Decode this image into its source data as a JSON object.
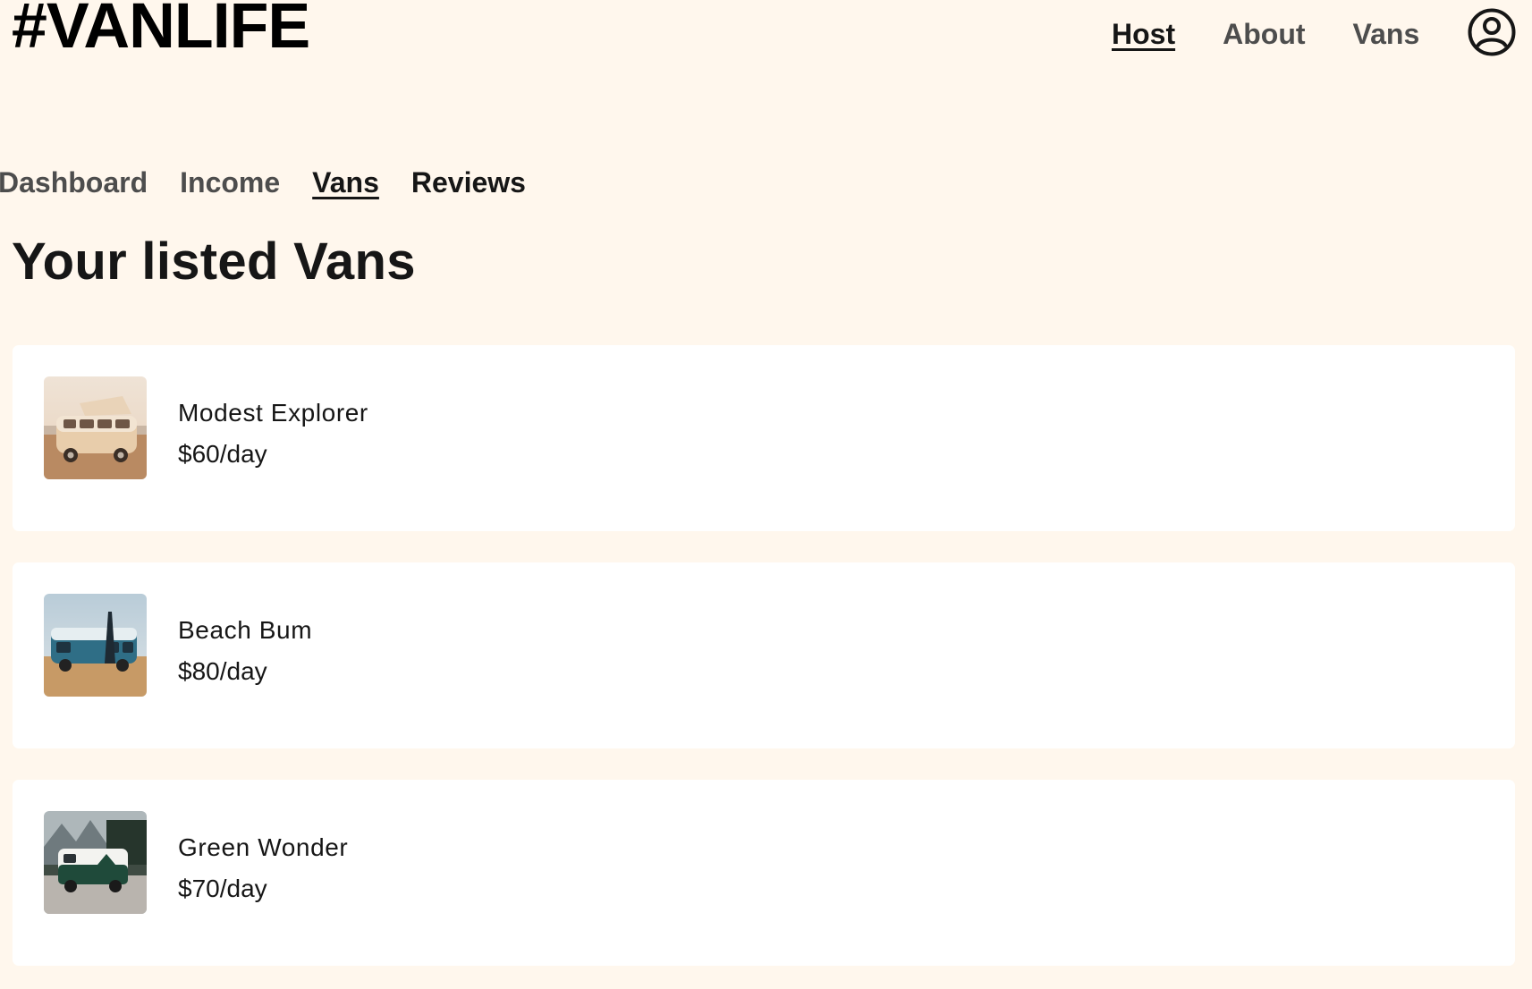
{
  "header": {
    "logo": "#VANLIFE",
    "nav": [
      {
        "label": "Host",
        "active": true
      },
      {
        "label": "About",
        "active": false
      },
      {
        "label": "Vans",
        "active": false
      }
    ],
    "avatar_icon": "user-circle-icon"
  },
  "host_nav": [
    {
      "label": "Dashboard",
      "active": false
    },
    {
      "label": "Income",
      "active": false
    },
    {
      "label": "Vans",
      "active": true
    },
    {
      "label": "Reviews",
      "active": false
    }
  ],
  "page": {
    "title": "Your listed Vans"
  },
  "vans": [
    {
      "name": "Modest Explorer",
      "price": "$60/day",
      "image": "tan-camper-van-photo"
    },
    {
      "name": "Beach Bum",
      "price": "$80/day",
      "image": "blue-camper-van-on-beach-photo"
    },
    {
      "name": "Green Wonder",
      "price": "$70/day",
      "image": "green-camper-van-mountains-photo"
    }
  ],
  "colors": {
    "background": "#FFF7ED",
    "card": "#FFFFFF",
    "text": "#161616",
    "muted_nav": "#4D4D4D"
  }
}
